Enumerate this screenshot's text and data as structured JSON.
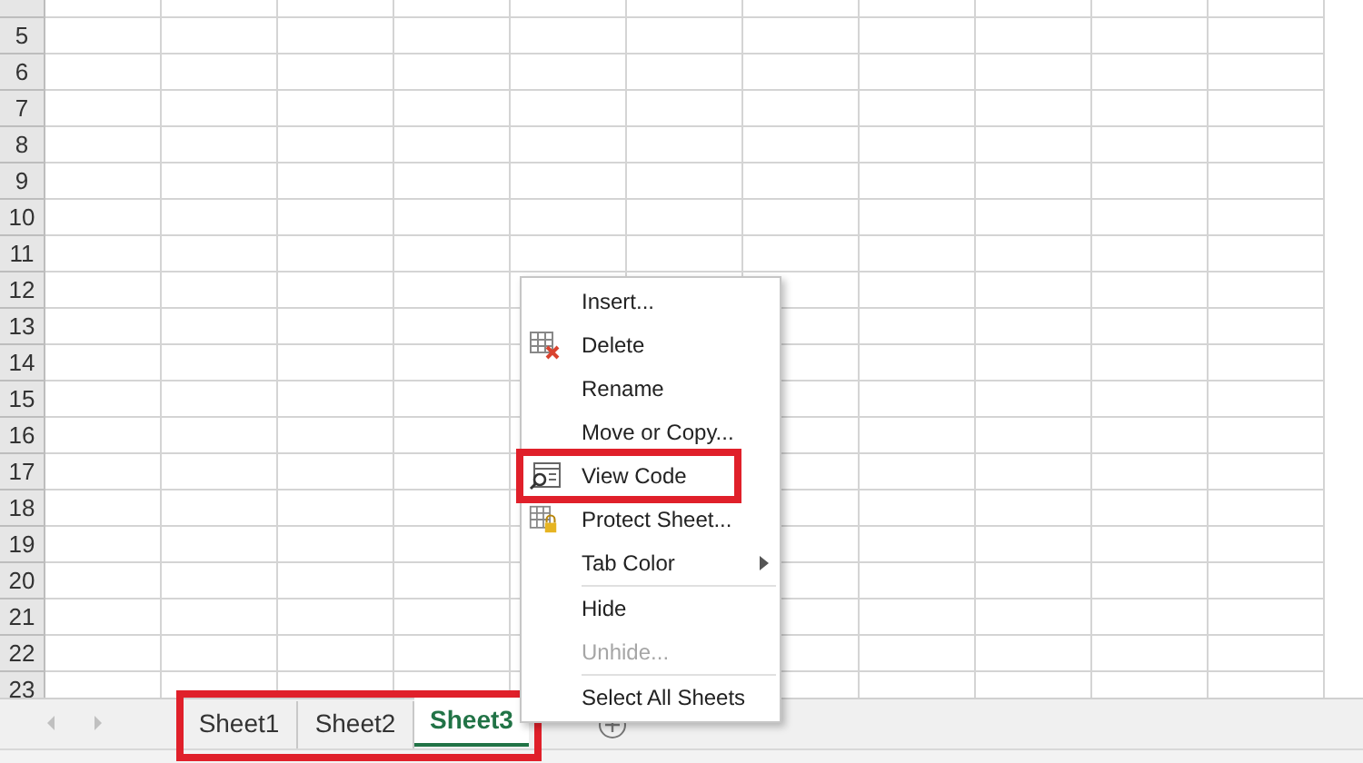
{
  "row_numbers": [
    "5",
    "6",
    "7",
    "8",
    "9",
    "10",
    "11",
    "12",
    "13",
    "14",
    "15",
    "16",
    "17",
    "18",
    "19",
    "20",
    "21",
    "22",
    "23"
  ],
  "sheet_tabs": {
    "highlighted": true,
    "tabs": [
      {
        "label": "Sheet1",
        "selected": false
      },
      {
        "label": "Sheet2",
        "selected": false
      },
      {
        "label": "Sheet3",
        "selected": true
      }
    ]
  },
  "context_menu": {
    "groups": [
      [
        {
          "label": "Insert...",
          "disabled": false,
          "highlighted": false,
          "submenu": false
        },
        {
          "label": "Delete",
          "disabled": false,
          "highlighted": false,
          "submenu": false
        },
        {
          "label": "Rename",
          "disabled": false,
          "highlighted": false,
          "submenu": false
        },
        {
          "label": "Move or Copy...",
          "disabled": false,
          "highlighted": false,
          "submenu": false
        },
        {
          "label": "View Code",
          "disabled": false,
          "highlighted": true,
          "submenu": false
        },
        {
          "label": "Protect Sheet...",
          "disabled": false,
          "highlighted": false,
          "submenu": false
        },
        {
          "label": "Tab Color",
          "disabled": false,
          "highlighted": false,
          "submenu": true
        }
      ],
      [
        {
          "label": "Hide",
          "disabled": false,
          "highlighted": false,
          "submenu": false
        },
        {
          "label": "Unhide...",
          "disabled": true,
          "highlighted": false,
          "submenu": false
        }
      ],
      [
        {
          "label": "Select All Sheets",
          "disabled": false,
          "highlighted": false,
          "submenu": false
        }
      ]
    ]
  }
}
